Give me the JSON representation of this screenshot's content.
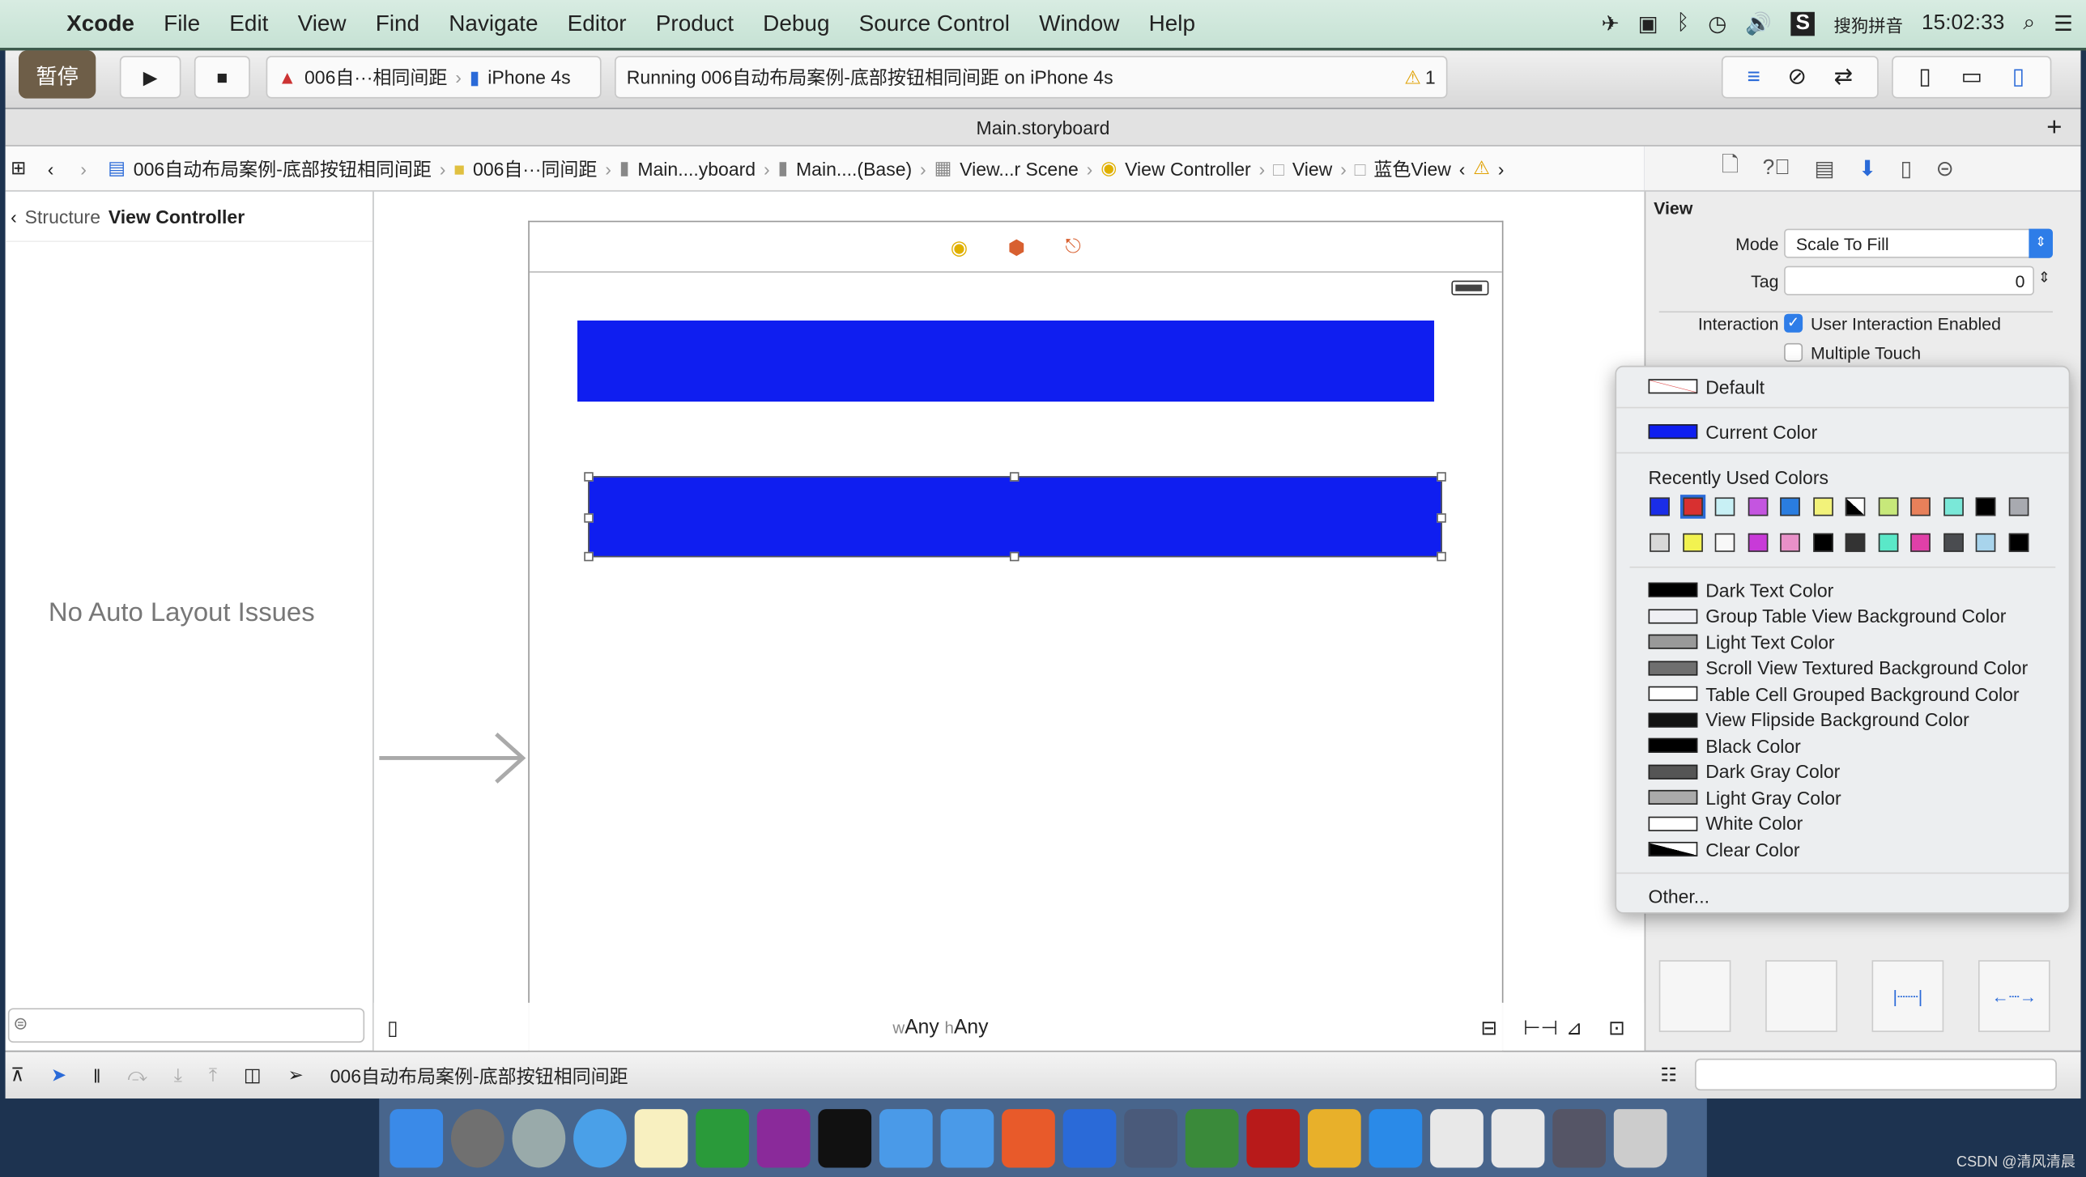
{
  "menubar": {
    "app": "Xcode",
    "items": [
      "File",
      "Edit",
      "View",
      "Find",
      "Navigate",
      "Editor",
      "Product",
      "Debug",
      "Source Control",
      "Window",
      "Help"
    ],
    "input_method": "搜狗拼音",
    "clock": "15:02:33"
  },
  "toolbar": {
    "pause_label": "暂停",
    "scheme": "006自···相同间距",
    "device": "iPhone 4s",
    "status": "Running 006自动布局案例-底部按钮相同间距 on iPhone 4s",
    "warning_count": "1"
  },
  "tab": {
    "title": "Main.storyboard",
    "add": "+"
  },
  "jumpbar": [
    "006自动布局案例-底部按钮相同间距",
    "006自···同间距",
    "Main....yboard",
    "Main....(Base)",
    "View...r Scene",
    "View Controller",
    "View",
    "蓝色View"
  ],
  "navigator": {
    "back": "Structure",
    "title": "View Controller",
    "message": "No Auto Layout Issues"
  },
  "canvas": {
    "size_w_prefix": "w",
    "size_w": "Any",
    "size_h_prefix": "h",
    "size_h": "Any",
    "view_color": "#0f1ef0"
  },
  "inspector": {
    "section": "View",
    "mode_label": "Mode",
    "mode_value": "Scale To Fill",
    "tag_label": "Tag",
    "tag_value": "0",
    "interaction_label": "Interaction",
    "user_interaction": {
      "label": "User Interaction Enabled",
      "checked": true
    },
    "multiple_touch": {
      "label": "Multiple Touch",
      "checked": false
    }
  },
  "color_popup": {
    "default": "Default",
    "current": "Current Color",
    "current_color": "#0f1ef0",
    "recent_title": "Recently Used Colors",
    "recent_colors": [
      [
        "#1a2de8",
        "#d83030",
        "#c8f0f5",
        "#c455e0",
        "#2a7de0",
        "#f2f27a",
        "black-white",
        "#c7e87a",
        "#e8805a",
        "#7ae8d8",
        "#000000",
        "#a8aab0"
      ],
      [
        "#d8d8d8",
        "#f2f250",
        "#f8f8f8",
        "#c83ad8",
        "#e890c8",
        "#000000",
        "#333333",
        "#5ae8c8",
        "#e040a8",
        "#4a4c50",
        "#a8d4ec",
        "#000000"
      ]
    ],
    "named": [
      {
        "label": "Dark Text Color",
        "color": "#000000"
      },
      {
        "label": "Group Table View Background Color",
        "color": "#efeff4"
      },
      {
        "label": "Light Text Color",
        "color": "#999999"
      },
      {
        "label": "Scroll View Textured Background Color",
        "color": "#6f6f6f"
      },
      {
        "label": "Table Cell Grouped Background Color",
        "color": "#ffffff"
      },
      {
        "label": "View Flipside Background Color",
        "color": "#121212"
      },
      {
        "label": "Black Color",
        "color": "#000000"
      },
      {
        "label": "Dark Gray Color",
        "color": "#555555"
      },
      {
        "label": "Light Gray Color",
        "color": "#aaaaaa"
      },
      {
        "label": "White Color",
        "color": "#ffffff"
      },
      {
        "label": "Clear Color",
        "color": "black-white"
      }
    ],
    "other": "Other..."
  },
  "bottombar": {
    "process": "006自动布局案例-底部按钮相同间距"
  },
  "watermark": "CSDN @清风清晨"
}
